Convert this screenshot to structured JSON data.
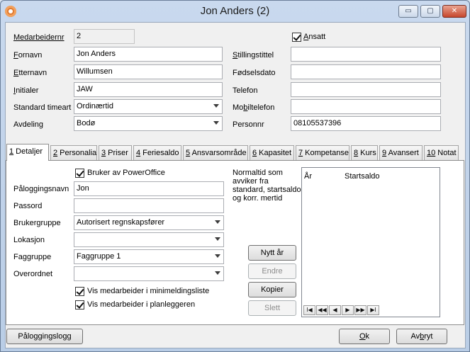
{
  "window": {
    "title": "Jon Anders (2)",
    "min": "▭",
    "max": "▢",
    "close": "✕"
  },
  "header": {
    "medarbeidernr": {
      "label": "Medarbeidernr",
      "value": "2"
    },
    "fornavn": {
      "label_u": "F",
      "label_rest": "ornavn",
      "value": "Jon Anders"
    },
    "etternavn": {
      "label_u": "E",
      "label_rest": "tternavn",
      "value": "Willumsen"
    },
    "initialer": {
      "label_u": "I",
      "label_rest": "nitialer",
      "value": "JAW"
    },
    "standard_timeart": {
      "label": "Standard timeart",
      "value": "Ordinærtid"
    },
    "avdeling": {
      "label": "Avdeling",
      "value": "Bodø"
    },
    "ansatt": {
      "label_u": "A",
      "label_rest": "nsatt",
      "checked": true
    },
    "stillingstittel": {
      "label_u": "S",
      "label_rest": "tillingstittel",
      "value": ""
    },
    "fodselsdato": {
      "label": "Fødselsdato",
      "value": ""
    },
    "telefon": {
      "label": "Telefon",
      "value": ""
    },
    "mobiltelefon": {
      "label_pre": "Mo",
      "label_u": "b",
      "label_rest": "iltelefon",
      "value": ""
    },
    "personnr": {
      "label": "Personnr",
      "value": "08105537396"
    }
  },
  "tabs": [
    {
      "num": "1",
      "label": " Detaljer",
      "active": true
    },
    {
      "num": "2",
      "label": " Personalia"
    },
    {
      "num": "3",
      "label": " Priser"
    },
    {
      "num": "4",
      "label": " Feriesaldo"
    },
    {
      "num": "5",
      "label": " Ansvarsområde"
    },
    {
      "num": "6",
      "label": " Kapasitet"
    },
    {
      "num": "7",
      "label": " Kompetanse"
    },
    {
      "num": "8",
      "label": " Kurs"
    },
    {
      "num": "9",
      "label": " Avansert"
    },
    {
      "num": "10",
      "label": " Notat"
    }
  ],
  "details": {
    "bruker_av_poweroffice": {
      "label": "Bruker av PowerOffice",
      "checked": true
    },
    "paloggingsnavn": {
      "label": "Påloggingsnavn",
      "value": "Jon"
    },
    "passord": {
      "label": "Passord",
      "value": ""
    },
    "brukergruppe": {
      "label": "Brukergruppe",
      "value": "Autorisert regnskapsfører"
    },
    "lokasjon": {
      "label": "Lokasjon",
      "value": ""
    },
    "faggruppe": {
      "label": "Faggruppe",
      "value": "Faggruppe 1"
    },
    "overordnet": {
      "label": "Overordnet",
      "value": ""
    },
    "vis_minimeldingsliste": {
      "label": "Vis medarbeider i minimeldingsliste",
      "checked": true
    },
    "vis_planleggeren": {
      "label": "Vis medarbeider i planleggeren",
      "checked": true
    }
  },
  "normaltid": {
    "note": [
      "Normaltid som",
      "avviker fra",
      "standard, startsaldo",
      "og korr. mertid"
    ],
    "col_ar": "År",
    "col_startsaldo": "Startsaldo",
    "buttons": {
      "nytt_ar": "Nytt år",
      "endre": "Endre",
      "kopier": "Kopier",
      "slett": "Slett"
    },
    "nav": [
      "I◀",
      "◀◀",
      "◀",
      "▶",
      "▶▶",
      "▶I"
    ]
  },
  "footer": {
    "paloggingslogg": "Påloggingslogg",
    "ok_u": "O",
    "ok_rest": "k",
    "avbryt_pre": "Av",
    "avbryt_u": "b",
    "avbryt_rest": "ryt"
  }
}
